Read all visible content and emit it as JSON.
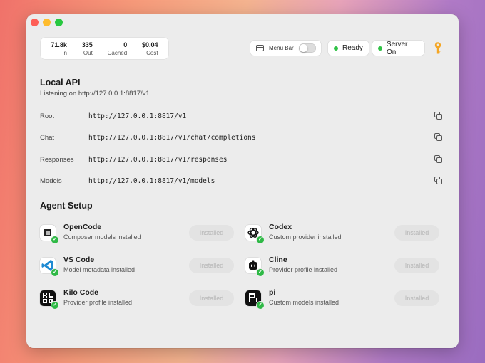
{
  "stats": [
    {
      "value": "71.8k",
      "label": "In"
    },
    {
      "value": "335",
      "label": "Out"
    },
    {
      "value": "0",
      "label": "Cached"
    },
    {
      "value": "$0.04",
      "label": "Cost"
    }
  ],
  "toolbar": {
    "menubar_label": "Menu Bar",
    "menubar_toggle_on": false,
    "ready_label": "Ready",
    "server_label": "Server On",
    "status_color": "#30c246",
    "key_color": "#f5a623"
  },
  "local_api": {
    "title": "Local API",
    "subtitle": "Listening on http://127.0.0.1:8817/v1",
    "endpoints": [
      {
        "label": "Root",
        "url": "http://127.0.0.1:8817/v1"
      },
      {
        "label": "Chat",
        "url": "http://127.0.0.1:8817/v1/chat/completions"
      },
      {
        "label": "Responses",
        "url": "http://127.0.0.1:8817/v1/responses"
      },
      {
        "label": "Models",
        "url": "http://127.0.0.1:8817/v1/models"
      }
    ]
  },
  "agent_setup": {
    "title": "Agent Setup",
    "agents": [
      {
        "name": "OpenCode",
        "desc": "Composer models installed",
        "button": "Installed",
        "icon": "opencode-icon"
      },
      {
        "name": "Codex",
        "desc": "Custom provider installed",
        "button": "Installed",
        "icon": "openai-icon"
      },
      {
        "name": "VS Code",
        "desc": "Model metadata installed",
        "button": "Installed",
        "icon": "vscode-icon"
      },
      {
        "name": "Cline",
        "desc": "Provider profile installed",
        "button": "Installed",
        "icon": "cline-icon"
      },
      {
        "name": "Kilo Code",
        "desc": "Provider profile installed",
        "button": "Installed",
        "icon": "kilocode-icon"
      },
      {
        "name": "pi",
        "desc": "Custom models installed",
        "button": "Installed",
        "icon": "pi-icon"
      }
    ]
  }
}
